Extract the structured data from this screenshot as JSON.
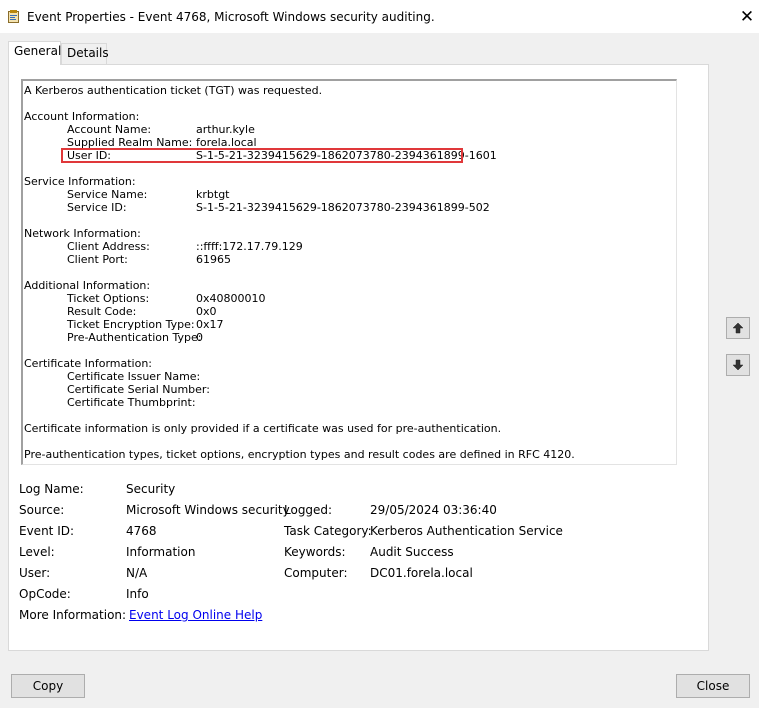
{
  "window": {
    "title": "Event Properties - Event 4768, Microsoft Windows security auditing."
  },
  "tabs": [
    {
      "label": "General"
    },
    {
      "label": "Details"
    }
  ],
  "description": {
    "summary": "A Kerberos authentication ticket (TGT) was requested.",
    "account": {
      "heading": "Account Information:",
      "rows": [
        {
          "key": "Account Name:",
          "value": "arthur.kyle"
        },
        {
          "key": "Supplied Realm Name:",
          "value": "forela.local"
        },
        {
          "key": "User ID:",
          "value": "S-1-5-21-3239415629-1862073780-2394361899-1601"
        }
      ]
    },
    "service": {
      "heading": "Service Information:",
      "rows": [
        {
          "key": "Service Name:",
          "value": "krbtgt"
        },
        {
          "key": "Service ID:",
          "value": "S-1-5-21-3239415629-1862073780-2394361899-502"
        }
      ]
    },
    "network": {
      "heading": "Network Information:",
      "rows": [
        {
          "key": "Client Address:",
          "value": "::ffff:172.17.79.129"
        },
        {
          "key": "Client Port:",
          "value": "61965"
        }
      ]
    },
    "additional": {
      "heading": "Additional Information:",
      "rows": [
        {
          "key": "Ticket Options:",
          "value": "0x40800010"
        },
        {
          "key": "Result Code:",
          "value": "0x0"
        },
        {
          "key": "Ticket Encryption Type:",
          "value": "0x17"
        },
        {
          "key": "Pre-Authentication Type:",
          "value": "0"
        }
      ]
    },
    "certificate": {
      "heading": "Certificate Information:",
      "rows": [
        {
          "key": "Certificate Issuer Name:"
        },
        {
          "key": "Certificate Serial Number:"
        },
        {
          "key": "Certificate Thumbprint:"
        }
      ]
    },
    "note1": "Certificate information is only provided if a certificate was used for pre-authentication.",
    "note2": "Pre-authentication types, ticket options, encryption types and result codes are defined in RFC 4120."
  },
  "fields": {
    "log_name": {
      "label": "Log Name:",
      "value": "Security"
    },
    "source": {
      "label": "Source:",
      "value": "Microsoft Windows security"
    },
    "logged": {
      "label": "Logged:",
      "value": "29/05/2024 03:36:40"
    },
    "event_id": {
      "label": "Event ID:",
      "value": "4768"
    },
    "task_category": {
      "label": "Task Category:",
      "value": "Kerberos Authentication Service"
    },
    "level": {
      "label": "Level:",
      "value": "Information"
    },
    "keywords": {
      "label": "Keywords:",
      "value": "Audit Success"
    },
    "user": {
      "label": "User:",
      "value": "N/A"
    },
    "computer": {
      "label": "Computer:",
      "value": "DC01.forela.local"
    },
    "opcode": {
      "label": "OpCode:",
      "value": "Info"
    },
    "more_info": {
      "label": "More Information:",
      "link": "Event Log Online Help"
    }
  },
  "buttons": {
    "copy": "Copy",
    "close": "Close"
  },
  "icons": {
    "title": "event-viewer-icon",
    "close": "close-icon",
    "up": "arrow-up-icon",
    "down": "arrow-down-icon"
  },
  "colors": {
    "highlight": "#e0383a",
    "link": "#0000ee"
  }
}
